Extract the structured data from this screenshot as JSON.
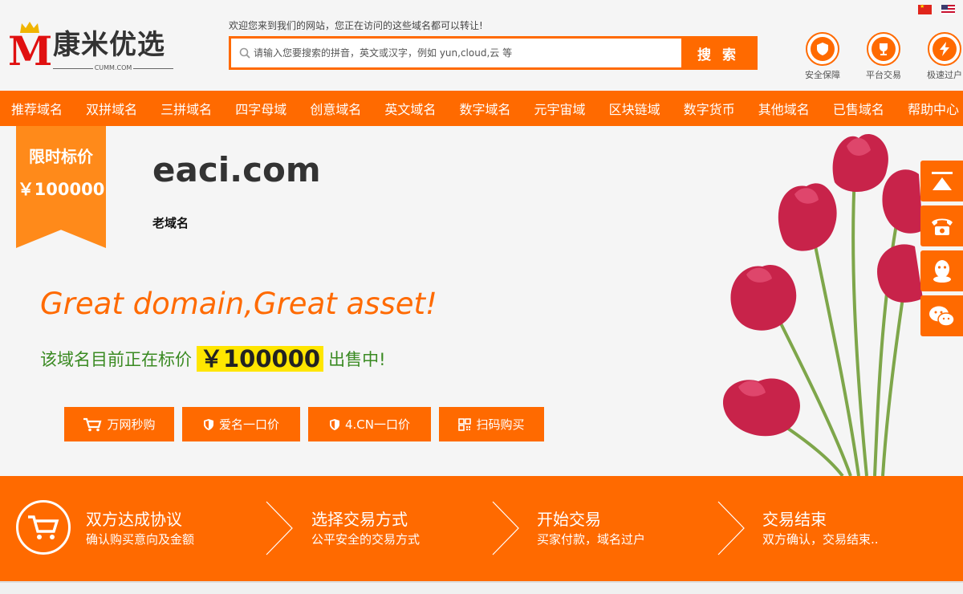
{
  "header": {
    "logo_name": "康米优选",
    "logo_sub": "CUMM.COM",
    "welcome": "欢迎您来到我们的网站，您正在访问的这些域名都可以转让!",
    "search_placeholder": "请输入您要搜索的拼音，英文或汉字，例如 yun,cloud,云 等",
    "search_button": "搜 索",
    "badges": [
      "安全保障",
      "平台交易",
      "极速过户"
    ]
  },
  "nav": [
    "推荐域名",
    "双拼域名",
    "三拼域名",
    "四字母域",
    "创意域名",
    "英文域名",
    "数字域名",
    "元宇宙域",
    "区块链域",
    "数字货币",
    "其他域名",
    "已售域名",
    "帮助中心"
  ],
  "ribbon": {
    "title": "限时标价",
    "price": "￥100000"
  },
  "domain": {
    "name": "eaci.com",
    "desc": "老域名"
  },
  "slogan": "Great domain,Great asset!",
  "sale": {
    "prefix": "该域名目前正在标价",
    "price": "￥100000",
    "suffix": "出售中!"
  },
  "buy_buttons": [
    "万网秒购",
    "爱名一口价",
    "4.CN一口价",
    "扫码购买"
  ],
  "process": [
    {
      "title": "双方达成协议",
      "sub": "确认购买意向及金额"
    },
    {
      "title": "选择交易方式",
      "sub": "公平安全的交易方式"
    },
    {
      "title": "开始交易",
      "sub": "买家付款，域名过户"
    },
    {
      "title": "交易结束",
      "sub": "双方确认，交易结束.."
    }
  ],
  "colors": {
    "accent": "#ff6a00",
    "highlight": "#ffe600",
    "green": "#3a8a22"
  }
}
